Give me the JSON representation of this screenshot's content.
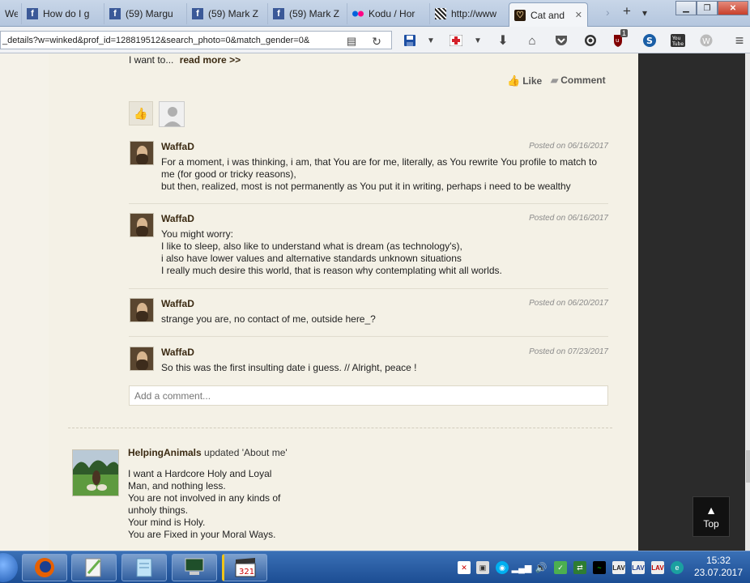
{
  "tabs": [
    {
      "label": "We",
      "icon": "generic-tab-icon"
    },
    {
      "label": "How do I g",
      "icon": "facebook-icon"
    },
    {
      "label": "(59) Margu",
      "icon": "facebook-icon"
    },
    {
      "label": "(59) Mark Z",
      "icon": "facebook-icon"
    },
    {
      "label": "(59) Mark Z",
      "icon": "facebook-icon"
    },
    {
      "label": "Kodu / Hor",
      "icon": "flickr-icon"
    },
    {
      "label": "http://www",
      "icon": "striped-tab-icon"
    },
    {
      "label": "Cat and",
      "icon": "heart-icon",
      "active": true
    }
  ],
  "tab_controls": {
    "new_tab": "+",
    "list_tabs": "▾",
    "scroll_right": "›"
  },
  "window_controls": {
    "minimize": "▁",
    "maximize": "❐",
    "close": "✕"
  },
  "url": "_details?w=winked&prof_id=128819512&search_photo=0&match_gender=0&",
  "addon_badge": "1",
  "page": {
    "intro_text": "I want to...",
    "read_more": "read more >>",
    "like_label": "Like",
    "comment_label": "Comment",
    "comments": [
      {
        "author": "WaffaD",
        "date": "Posted on 06/16/2017",
        "lines": [
          "For a moment, i was thinking, i am, that You are for me, literally, as You rewrite You profile to match to",
          "me (for good or tricky reasons),",
          "but then, realized, most is not permanently as You put it in writing, perhaps i need to be wealthy"
        ]
      },
      {
        "author": "WaffaD",
        "date": "Posted on 06/16/2017",
        "lines": [
          "You might worry:",
          "I like to sleep, also like to understand what is dream (as technology's),",
          "i also have lower values and alternative standards unknown situations",
          "I really much desire this world, that is reason why contemplating whit all worlds."
        ]
      },
      {
        "author": "WaffaD",
        "date": "Posted on 06/20/2017",
        "lines": [
          "strange you are, no contact of me, outside here_?"
        ]
      },
      {
        "author": "WaffaD",
        "date": "Posted on 07/23/2017",
        "lines": [
          "So this was the first insulting date i guess. // Alright, peace !"
        ]
      }
    ],
    "add_comment_placeholder": "Add a comment...",
    "update": {
      "author": "HelpingAnimals",
      "action": "updated 'About me'",
      "lines": [
        "I want a Hardcore Holy and Loyal",
        "Man, and nothing less.",
        "You are not involved in any kinds of",
        "unholy things.",
        "Your mind is Holy.",
        "You are Fixed in your Moral Ways."
      ]
    },
    "top_button": "Top"
  },
  "taskbar": {
    "time": "15:32",
    "date": "23.07.2017",
    "tray_icons": [
      "skype-icon",
      "network-icon",
      "signal-icon",
      "volume-icon",
      "shield-icon",
      "flag-icon",
      "monitor-icon",
      "lav-icon",
      "lav-icon",
      "lav-icon",
      "status-icon"
    ],
    "lav_label": "LAV"
  },
  "colors": {
    "page_bg": "#f5f2e9",
    "author_link": "#3b2a12",
    "taskbar": "#1c4d93"
  }
}
